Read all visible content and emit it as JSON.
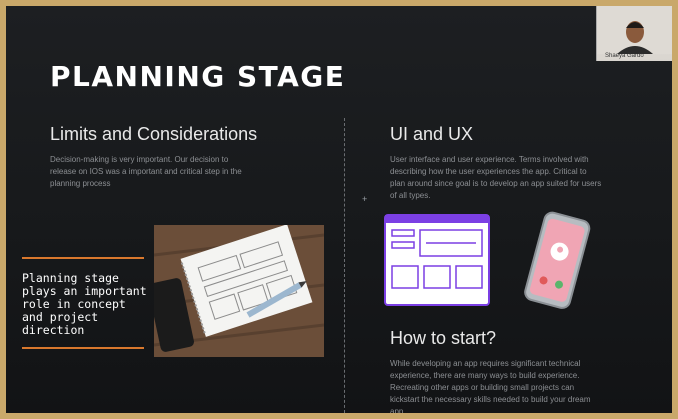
{
  "slide": {
    "title": "PLANNING STAGE",
    "left": {
      "heading": "Limits and Considerations",
      "body": "Decision-making is very important. Our decision to release on IOS was a important and critical step in the planning process",
      "callout": "Planning stage plays an important role in concept and project direction"
    },
    "right": {
      "heading": "UI and UX",
      "body": "User interface and user experience. Terms involved with describing how the user experiences the app. Critical to plan around since goal is to develop an app suited for users of all types.",
      "heading2": "How to start?",
      "body2": "While developing an app requires significant technical experience, there are many ways to build experience. Recreating other apps or building small projects can kickstart the necessary skills needed to build your dream app."
    },
    "plus_symbol": "+"
  },
  "webcam": {
    "name": "Shaeya Gardo"
  },
  "colors": {
    "accent_orange": "#d9782d",
    "illustration_purple": "#7b3fe4",
    "phone_pink": "#f0a5b4"
  }
}
